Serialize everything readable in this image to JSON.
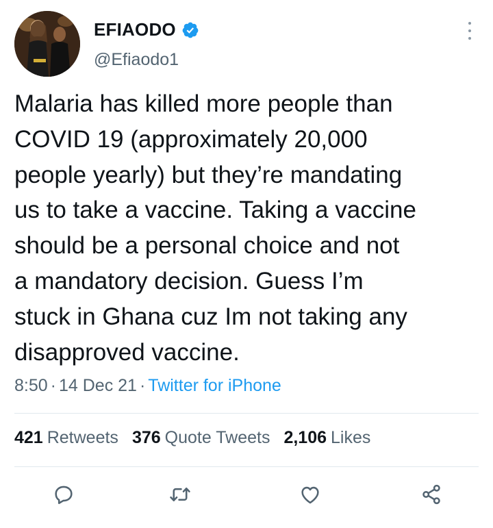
{
  "user": {
    "display_name": "EFIAODO",
    "handle": "@Efiaodo1",
    "verified": true
  },
  "tweet": {
    "text": "Malaria has killed more people than\nCOVID 19 (approximately 20,000\npeople yearly) but they’re mandating\nus to take a vaccine. Taking a vaccine\nshould be a personal choice and not\na mandatory decision. Guess I’m\nstuck in Ghana cuz Im not  taking  any\ndisapproved vaccine.",
    "time": "8:50",
    "date": "14 Dec 21",
    "separator": "·",
    "source": "Twitter for iPhone"
  },
  "stats": {
    "retweets": {
      "count": "421",
      "label": "Retweets"
    },
    "quotes": {
      "count": "376",
      "label": "Quote Tweets"
    },
    "likes": {
      "count": "2,106",
      "label": "Likes"
    }
  },
  "actions": {
    "icons": [
      "reply-icon",
      "retweet-icon",
      "like-icon",
      "share-icon"
    ]
  },
  "colors": {
    "text": "#0f1419",
    "muted": "#536471",
    "link": "#1d9bf0",
    "verified": "#1d9bf0",
    "divider": "#e1e8ed"
  }
}
